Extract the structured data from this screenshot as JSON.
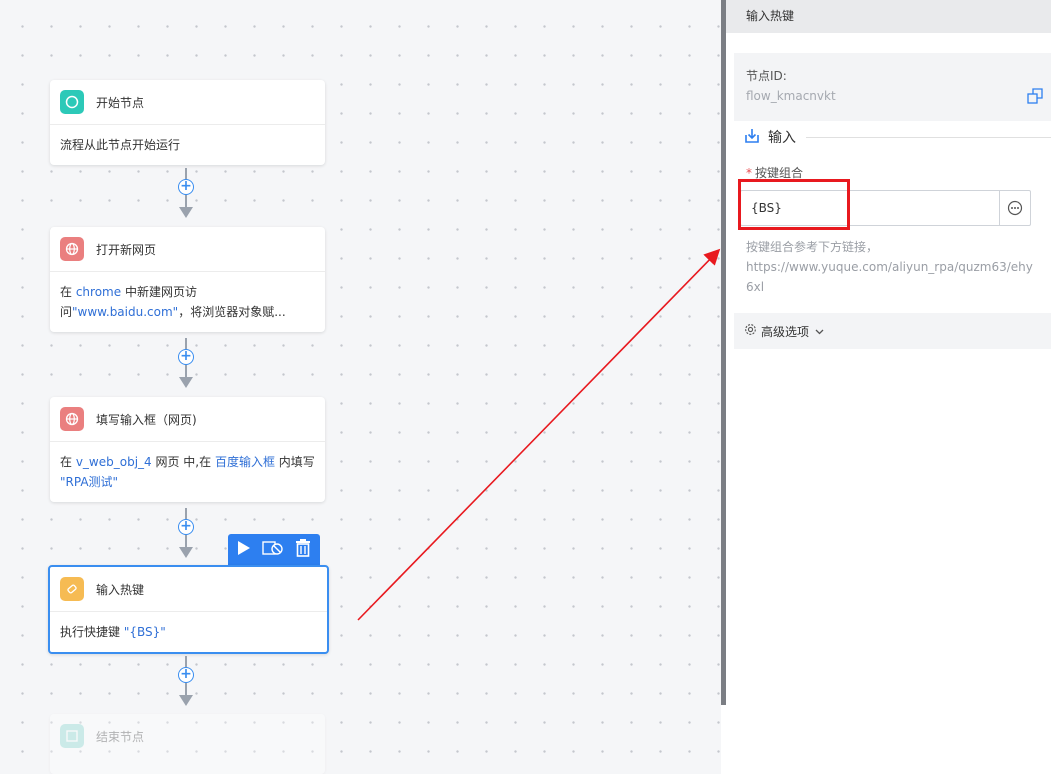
{
  "nodes": [
    {
      "title": "开始节点",
      "body": "流程从此节点开始运行"
    },
    {
      "title": "打开新网页",
      "body_parts": [
        "在 ",
        "chrome",
        " 中新建网页访问",
        "\"www.baidu.com\"",
        "，将浏览器对象赋..."
      ]
    },
    {
      "title": "填写输入框（网页)",
      "body_parts": [
        "在 ",
        "v_web_obj_4",
        " 网页 中,在 ",
        "百度输入框",
        " 内填写 ",
        "\"RPA测试\""
      ]
    },
    {
      "title": "输入热键",
      "body_parts": [
        "执行快捷键 ",
        "\"{BS}\""
      ]
    },
    {
      "title": "结束节点"
    }
  ],
  "panel": {
    "title": "输入热键",
    "node_id_label": "节点ID:",
    "node_id_value": "flow_kmacnvkt",
    "input_section": "输入",
    "combo_label": "按键组合",
    "required_mark": "*",
    "combo_value": "{BS}",
    "hint_line1": "按键组合参考下方链接，",
    "hint_url": "https://www.yuque.com/aliyun_rpa/quzm63/ehy6xl",
    "advanced_label": "高级选项"
  },
  "colors": {
    "accent": "#2d7ff0",
    "highlight_text": "#2f6fd6",
    "annotation_red": "#e8191f"
  },
  "icons": [
    "circle-icon",
    "globe-icon",
    "eraser-icon",
    "play-icon",
    "breakpoint-icon",
    "trash-icon",
    "copy-icon",
    "import-icon",
    "more-icon",
    "settings-icon",
    "chevron-down-icon",
    "plus-icon"
  ]
}
